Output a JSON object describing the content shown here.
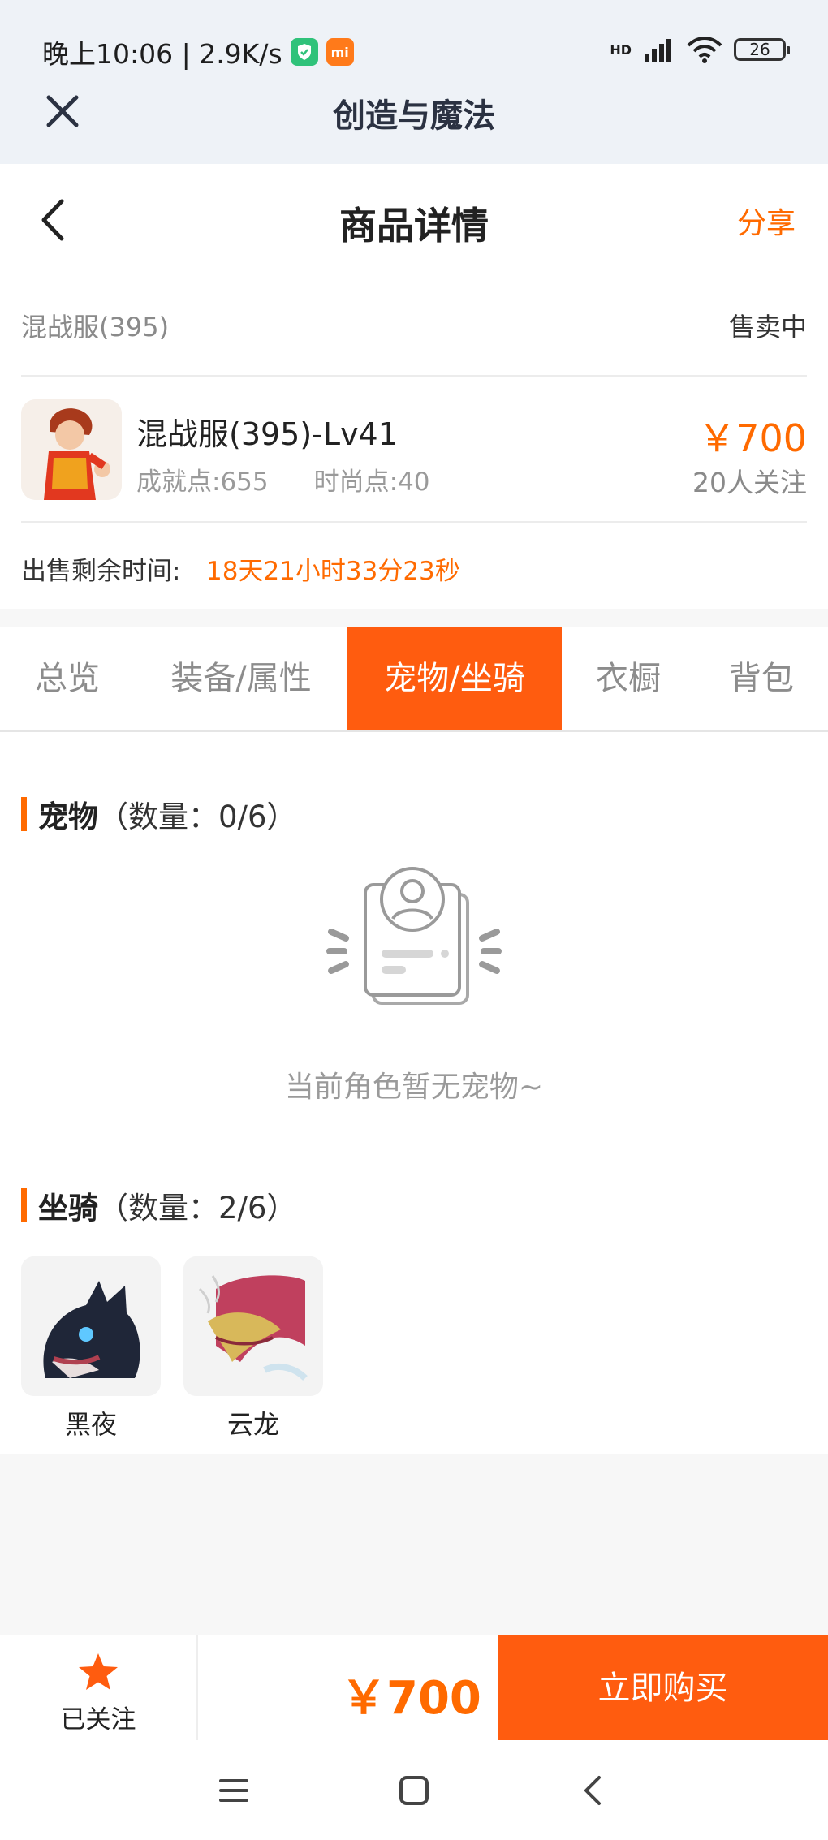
{
  "status": {
    "time_speed": "晚上10:06 | 2.9K/s",
    "shield_icon": "shield-badge-icon",
    "mi_label": "mi",
    "network": "HD",
    "battery": "26"
  },
  "appbar": {
    "title": "创造与魔法"
  },
  "header": {
    "title": "商品详情",
    "share": "分享"
  },
  "product": {
    "server": "混战服(395)",
    "status": "售卖中",
    "title": "混战服(395)-Lv41",
    "achievement": "成就点:655",
    "fashion": "时尚点:40",
    "price": "￥700",
    "followers": "20人关注",
    "remaining_label": "出售剩余时间:",
    "remaining_value": "18天21小时33分23秒"
  },
  "tabs": [
    {
      "label": "总览"
    },
    {
      "label": "装备/属性"
    },
    {
      "label": "宠物/坐骑"
    },
    {
      "label": "衣橱"
    },
    {
      "label": "背包"
    }
  ],
  "pets": {
    "title": "宠物",
    "count": "（数量：0/6）",
    "empty_text": "当前角色暂无宠物~"
  },
  "mounts": {
    "title": "坐骑",
    "count": "（数量：2/6）",
    "items": [
      {
        "name": "黑夜"
      },
      {
        "name": "云龙"
      }
    ]
  },
  "bottom": {
    "follow_label": "已关注",
    "price": "￥700",
    "buy_label": "立即购买"
  },
  "colors": {
    "accent": "#ff5c0f",
    "price": "#ff6a00"
  }
}
